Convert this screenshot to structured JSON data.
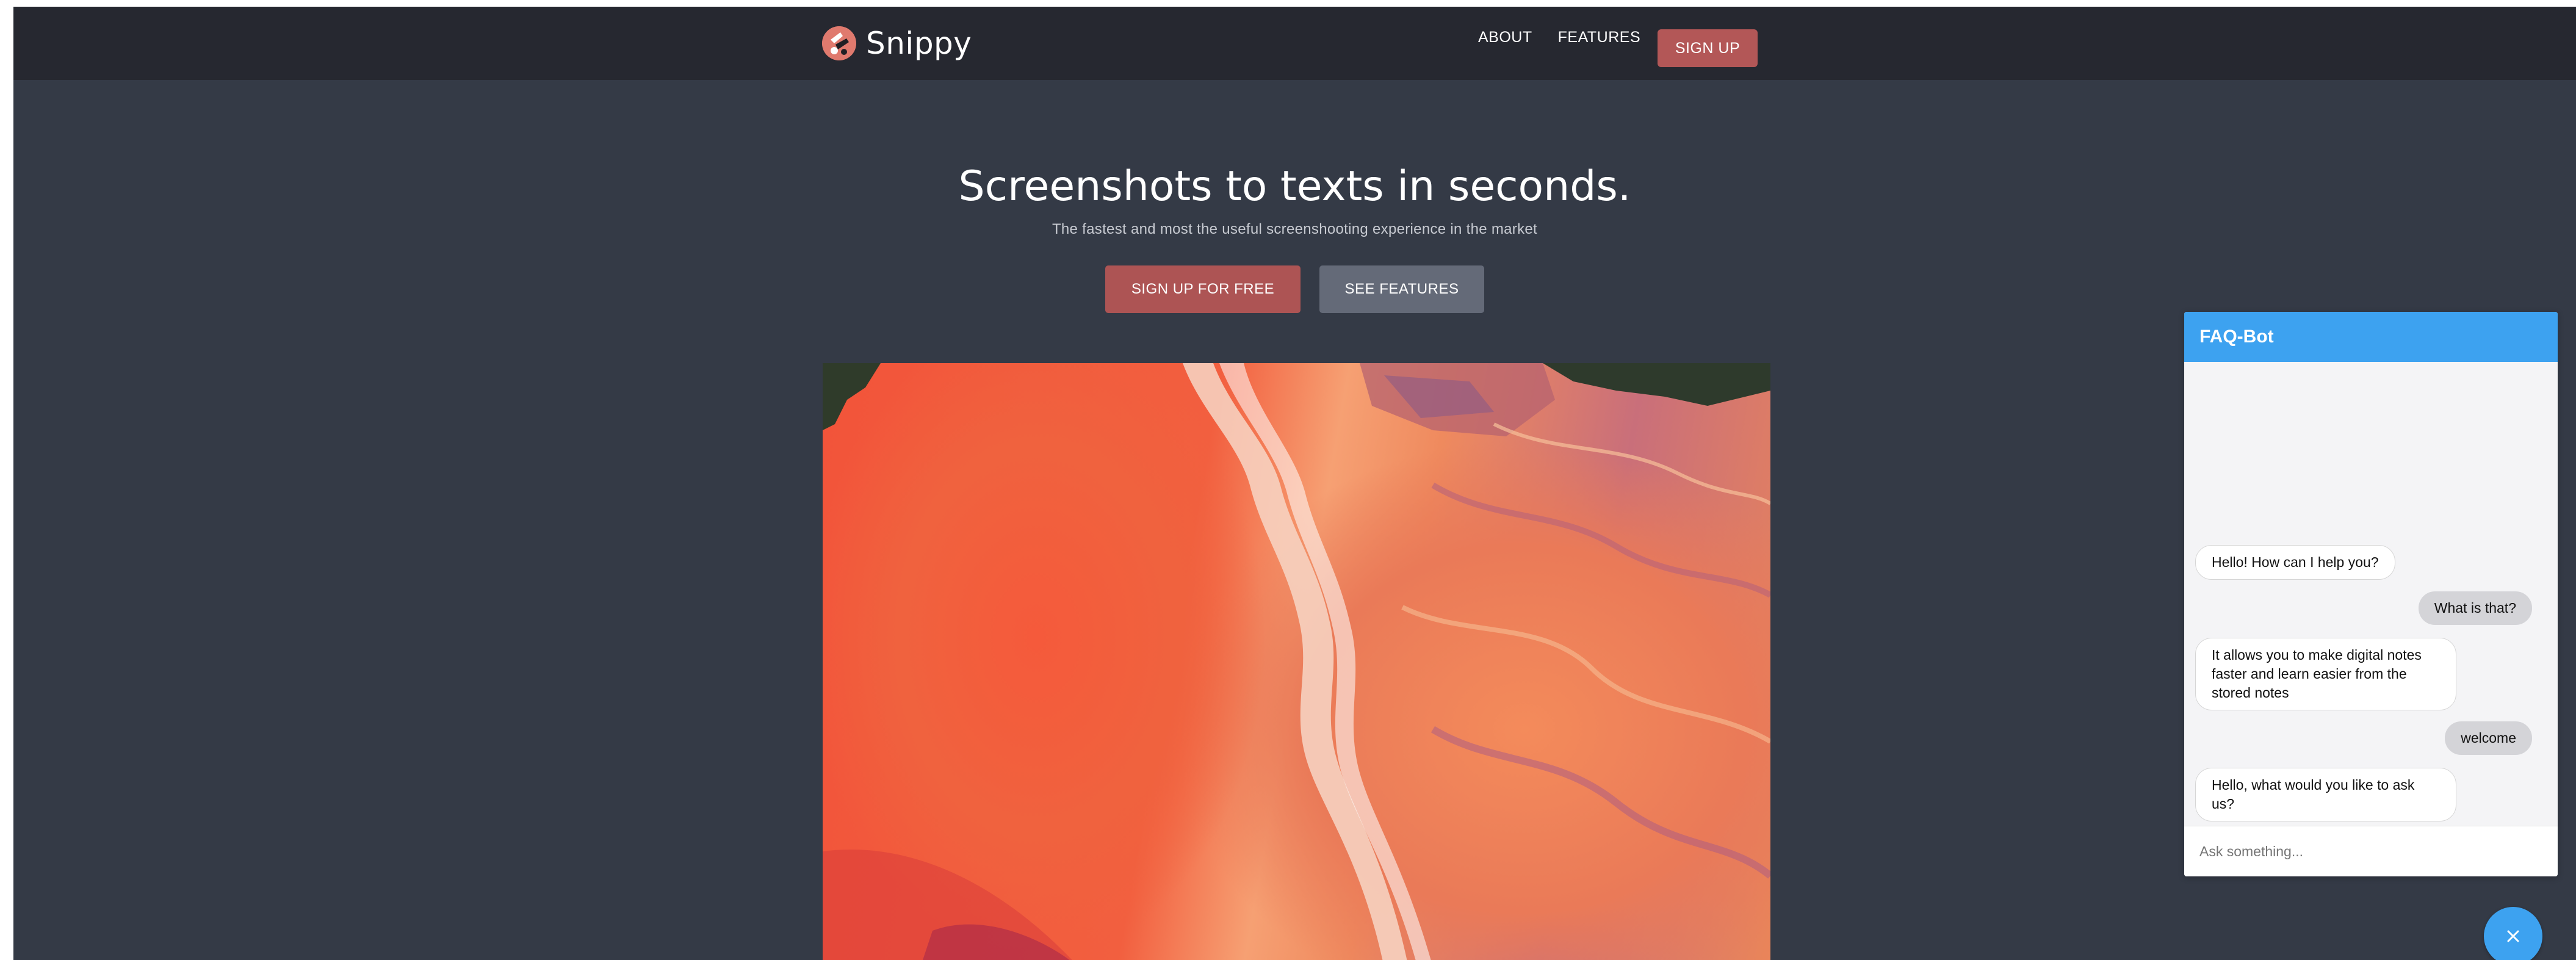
{
  "navbar": {
    "brand": "Snippy",
    "logo_icon": "snippy-logo-icon",
    "links": [
      "ABOUT",
      "FEATURES"
    ],
    "signup_label": "SIGN UP"
  },
  "hero": {
    "title": "Screenshots to texts in seconds.",
    "subtitle": "The fastest and most the useful screenshooting experience in the market",
    "primary_button": "SIGN UP FOR FREE",
    "secondary_button": "SEE FEATURES"
  },
  "chat": {
    "title": "FAQ-Bot",
    "messages": [
      {
        "from": "bot",
        "text": "Hello! How can I help you?"
      },
      {
        "from": "user",
        "text": "What is that?"
      },
      {
        "from": "bot",
        "text": "It allows you to make digital notes faster and learn easier from the stored notes"
      },
      {
        "from": "user",
        "text": "welcome"
      },
      {
        "from": "bot",
        "text": "Hello, what would you like to ask us?"
      }
    ],
    "input_placeholder": "Ask something...",
    "close_icon": "close-icon"
  },
  "colors": {
    "nav_bg": "#262830",
    "page_bg": "#343a46",
    "accent_red": "#ad5454",
    "button_gray": "#646a78",
    "chat_blue": "#3da2f0"
  }
}
